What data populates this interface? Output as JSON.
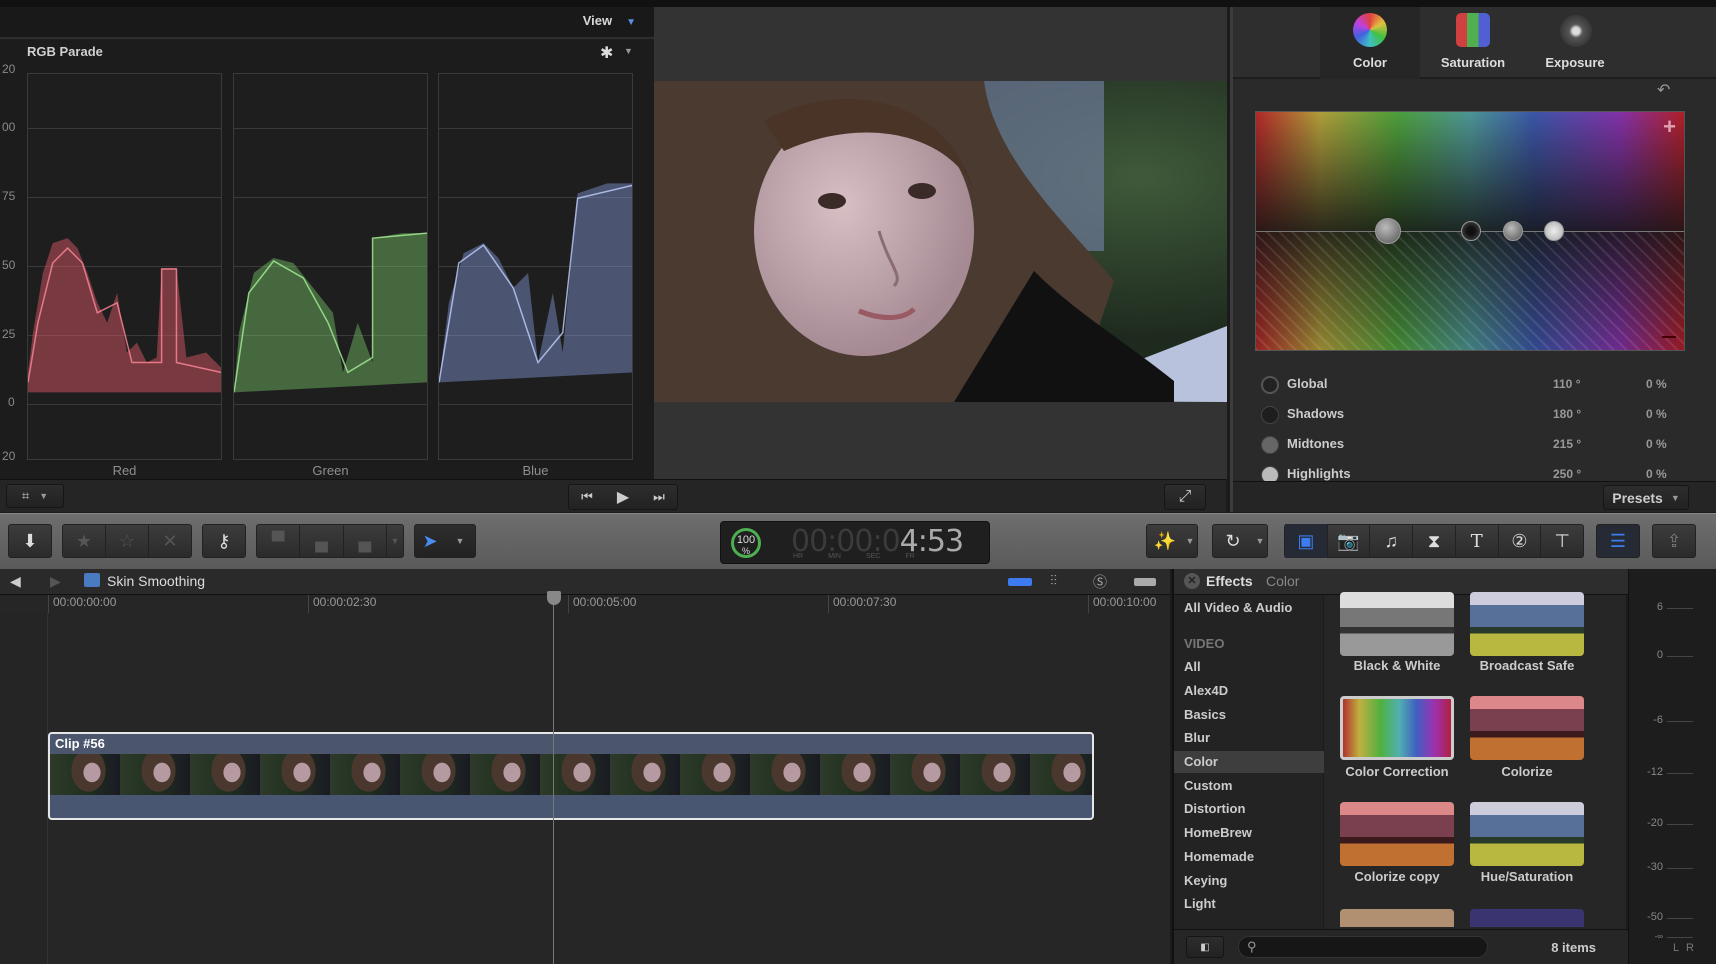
{
  "scopes": {
    "view_label": "View",
    "title": "RGB Parade",
    "y_axis": [
      "20",
      "00",
      "75",
      "50",
      "25",
      "0",
      "20"
    ],
    "channels": [
      {
        "name": "Red",
        "color": "#e85a6a"
      },
      {
        "name": "Green",
        "color": "#7fd870"
      },
      {
        "name": "Blue",
        "color": "#8fa8f0"
      }
    ]
  },
  "inspector": {
    "tabs": [
      {
        "label": "Color",
        "icon": "color-wheel-icon"
      },
      {
        "label": "Saturation",
        "icon": "saturation-icon"
      },
      {
        "label": "Exposure",
        "icon": "exposure-icon"
      }
    ],
    "ranges": [
      {
        "name": "Global",
        "angle": "110 °",
        "percent": "0 %"
      },
      {
        "name": "Shadows",
        "angle": "180 °",
        "percent": "0 %"
      },
      {
        "name": "Midtones",
        "angle": "215 °",
        "percent": "0 %"
      },
      {
        "name": "Highlights",
        "angle": "250 °",
        "percent": "0 %"
      }
    ],
    "presets_label": "Presets"
  },
  "toolbar": {
    "timecode": {
      "dim": "00:00:0",
      "bright": "4:53",
      "units": [
        "HR",
        "MIN",
        "SEC",
        "FR"
      ],
      "progress_label": "100",
      "progress_unit": "%"
    }
  },
  "timeline": {
    "project_name": "Skin Smoothing",
    "ruler": [
      "00:00:00:00",
      "00:00:02:30",
      "00:00:05:00",
      "00:00:07:30",
      "00:00:10:00"
    ],
    "clip_name": "Clip #56"
  },
  "effects": {
    "title": "Effects",
    "category_title": "Color",
    "all_label": "All Video & Audio",
    "section": "VIDEO",
    "categories": [
      "All",
      "Alex4D",
      "Basics",
      "Blur",
      "Color",
      "Custom",
      "Distortion",
      "HomeBrew",
      "Homemade",
      "Keying",
      "Light"
    ],
    "selected": "Color",
    "items": [
      "Black & White",
      "Broadcast Safe",
      "Color Correction",
      "Colorize",
      "Colorize copy",
      "Hue/Saturation"
    ],
    "count": "8 items",
    "search_placeholder": ""
  },
  "audio_meter": {
    "labels": [
      "6",
      "0",
      "-6",
      "-12",
      "-20",
      "-30",
      "-50",
      "-∞"
    ],
    "channels": [
      "L",
      "R"
    ]
  }
}
